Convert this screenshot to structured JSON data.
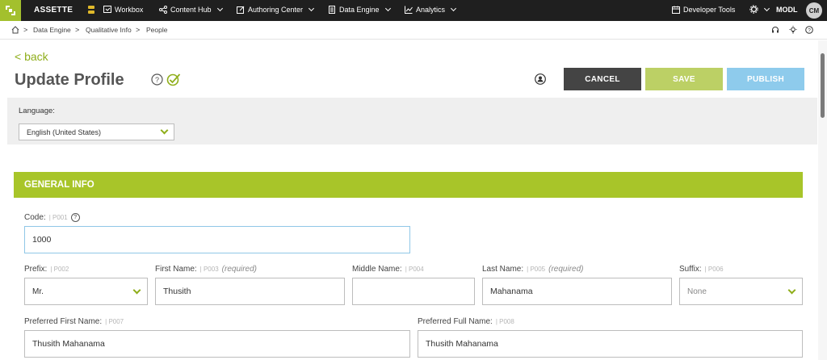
{
  "topbar": {
    "brand": "ASSETTE",
    "nav": {
      "workbox": "Workbox",
      "content_hub": "Content Hub",
      "authoring_center": "Authoring Center",
      "data_engine": "Data Engine",
      "analytics": "Analytics"
    },
    "developer_tools": "Developer Tools",
    "env": "MODL",
    "avatar": "CM"
  },
  "breadcrumb": [
    "Data Engine",
    "Qualitative Info",
    "People"
  ],
  "header": {
    "back": "< back",
    "title": "Update Profile",
    "help_glyph": "?",
    "cancel": "CANCEL",
    "save": "SAVE",
    "publish": "PUBLISH"
  },
  "language": {
    "label": "Language:",
    "value": "English (United States)"
  },
  "section": {
    "title": "GENERAL INFO"
  },
  "fields": {
    "code": {
      "label": "Code:",
      "code": "| P001",
      "value": "1000",
      "help_glyph": "?"
    },
    "prefix": {
      "label": "Prefix:",
      "code": "| P002",
      "value": "Mr."
    },
    "first_name": {
      "label": "First Name:",
      "code": "| P003",
      "req": "(required)",
      "value": "Thusith"
    },
    "middle_name": {
      "label": "Middle Name:",
      "code": "| P004",
      "value": ""
    },
    "last_name": {
      "label": "Last Name:",
      "code": "| P005",
      "req": "(required)",
      "value": "Mahanama"
    },
    "suffix": {
      "label": "Suffix:",
      "code": "| P006",
      "value": "None"
    },
    "preferred_first": {
      "label": "Preferred First Name:",
      "code": "| P007",
      "value": "Thusith Mahanama"
    },
    "preferred_full": {
      "label": "Preferred Full Name:",
      "code": "| P008",
      "value": "Thusith Mahanama"
    }
  },
  "colors": {
    "accent_green": "#a8c529",
    "cancel_bg": "#444444",
    "publish_bg": "#8ecbec",
    "topbar_bg": "#1f1f1f"
  }
}
